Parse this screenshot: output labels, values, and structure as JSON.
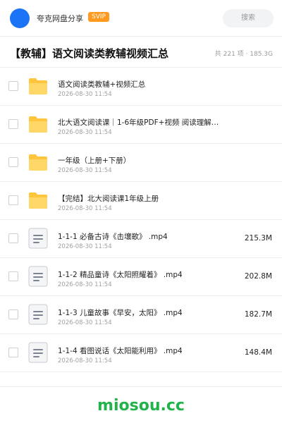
{
  "header": {
    "brand": "夸克网盘分享",
    "badge": "SVIP",
    "search_placeholder": "搜索"
  },
  "folder": {
    "title": "【教辅】语文阅读类教辅视频汇总",
    "stats": "共 221 项 · 185.3G"
  },
  "files": [
    {
      "name": "语文阅读类教辅+视频汇总",
      "date": "2026-08-30 11:54",
      "size": "",
      "type": "folder"
    },
    {
      "name": "北大语文阅读课｜1-6年级PDF+视频  阅读理解…",
      "date": "2026-08-30 11:54",
      "size": "",
      "type": "folder"
    },
    {
      "name": "一年级（上册+下册）",
      "date": "2026-08-30 11:54",
      "size": "",
      "type": "folder"
    },
    {
      "name": "【完结】北大阅读课1年级上册",
      "date": "2026-08-30 11:54",
      "size": "",
      "type": "folder"
    },
    {
      "name": "1-1-1 必备古诗《击壤歌》 .mp4",
      "date": "2026-08-30 11:54",
      "size": "215.3M",
      "type": "video"
    },
    {
      "name": "1-1-2 精品童诗《太阳照耀着》 .mp4",
      "date": "2026-08-30 11:54",
      "size": "202.8M",
      "type": "video"
    },
    {
      "name": "1-1-3 儿童故事《早安，太阳》 .mp4",
      "date": "2026-08-30 11:54",
      "size": "182.7M",
      "type": "video"
    },
    {
      "name": "1-1-4 看图说话《太阳能利用》 .mp4",
      "date": "2026-08-30 11:54",
      "size": "148.4M",
      "type": "video"
    }
  ],
  "footer": {
    "watermark": "miosou.cc"
  },
  "colors": {
    "accent": "#1b73f6",
    "svip": "#ff9a1f",
    "folder": "#ffc53d",
    "watermark": "#22b24c"
  },
  "icons": {
    "folder": "folder-icon",
    "video": "file-icon",
    "avatar": "avatar"
  }
}
